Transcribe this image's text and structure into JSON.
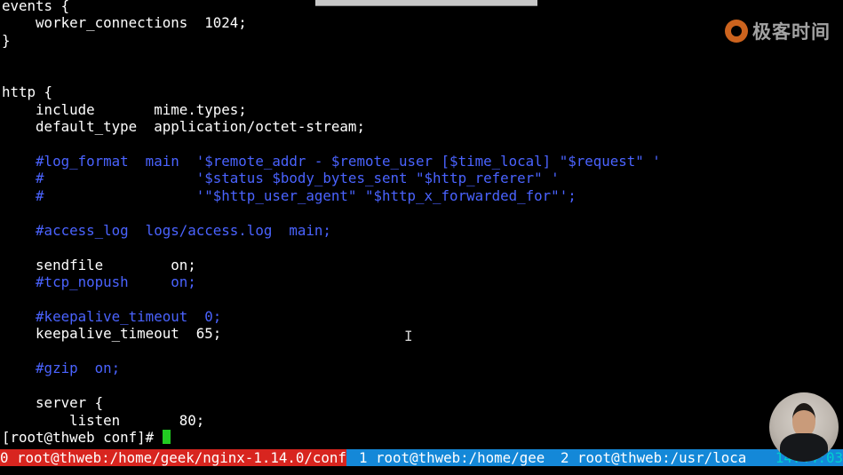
{
  "terminal": {
    "lines": [
      {
        "text": "events {",
        "comment": false
      },
      {
        "text": "    worker_connections  1024;",
        "comment": false
      },
      {
        "text": "}",
        "comment": false
      },
      {
        "text": "",
        "comment": false
      },
      {
        "text": "",
        "comment": false
      },
      {
        "text": "http {",
        "comment": false
      },
      {
        "text": "    include       mime.types;",
        "comment": false
      },
      {
        "text": "    default_type  application/octet-stream;",
        "comment": false
      },
      {
        "text": "",
        "comment": false
      },
      {
        "text": "    #log_format  main  '$remote_addr - $remote_user [$time_local] \"$request\" '",
        "comment": true
      },
      {
        "text": "    #                  '$status $body_bytes_sent \"$http_referer\" '",
        "comment": true
      },
      {
        "text": "    #                  '\"$http_user_agent\" \"$http_x_forwarded_for\"';",
        "comment": true
      },
      {
        "text": "",
        "comment": false
      },
      {
        "text": "    #access_log  logs/access.log  main;",
        "comment": true
      },
      {
        "text": "",
        "comment": false
      },
      {
        "text": "    sendfile        on;",
        "comment": false
      },
      {
        "text": "    #tcp_nopush     on;",
        "comment": true
      },
      {
        "text": "",
        "comment": false
      },
      {
        "text": "    #keepalive_timeout  0;",
        "comment": true
      },
      {
        "text": "    keepalive_timeout  65;",
        "comment": false
      },
      {
        "text": "",
        "comment": false
      },
      {
        "text": "    #gzip  on;",
        "comment": true
      },
      {
        "text": "",
        "comment": false
      },
      {
        "text": "    server {",
        "comment": false
      },
      {
        "text": "        listen       80;",
        "comment": false
      }
    ],
    "prompt": "[root@thweb conf]# "
  },
  "statusbar": {
    "windows": [
      {
        "label": "0 root@thweb:/home/geek/nginx-1.14.0/conf",
        "active": true
      },
      {
        "label": "1 root@thweb:/home/gee",
        "active": false
      },
      {
        "label": "2 root@thweb:/usr/loca",
        "active": false
      }
    ],
    "clock": "14:44:03"
  },
  "logo": {
    "text": "极客时间",
    "icon": "geektime-logo-icon"
  },
  "colors": {
    "background": "#000000",
    "text": "#ffffff",
    "comment": "#4a63ff",
    "cursor": "#22cc22",
    "status_bar": "#1488d8",
    "active_window": "#d8251f",
    "clock": "#00d0d0",
    "logo_accent": "#f07524"
  }
}
